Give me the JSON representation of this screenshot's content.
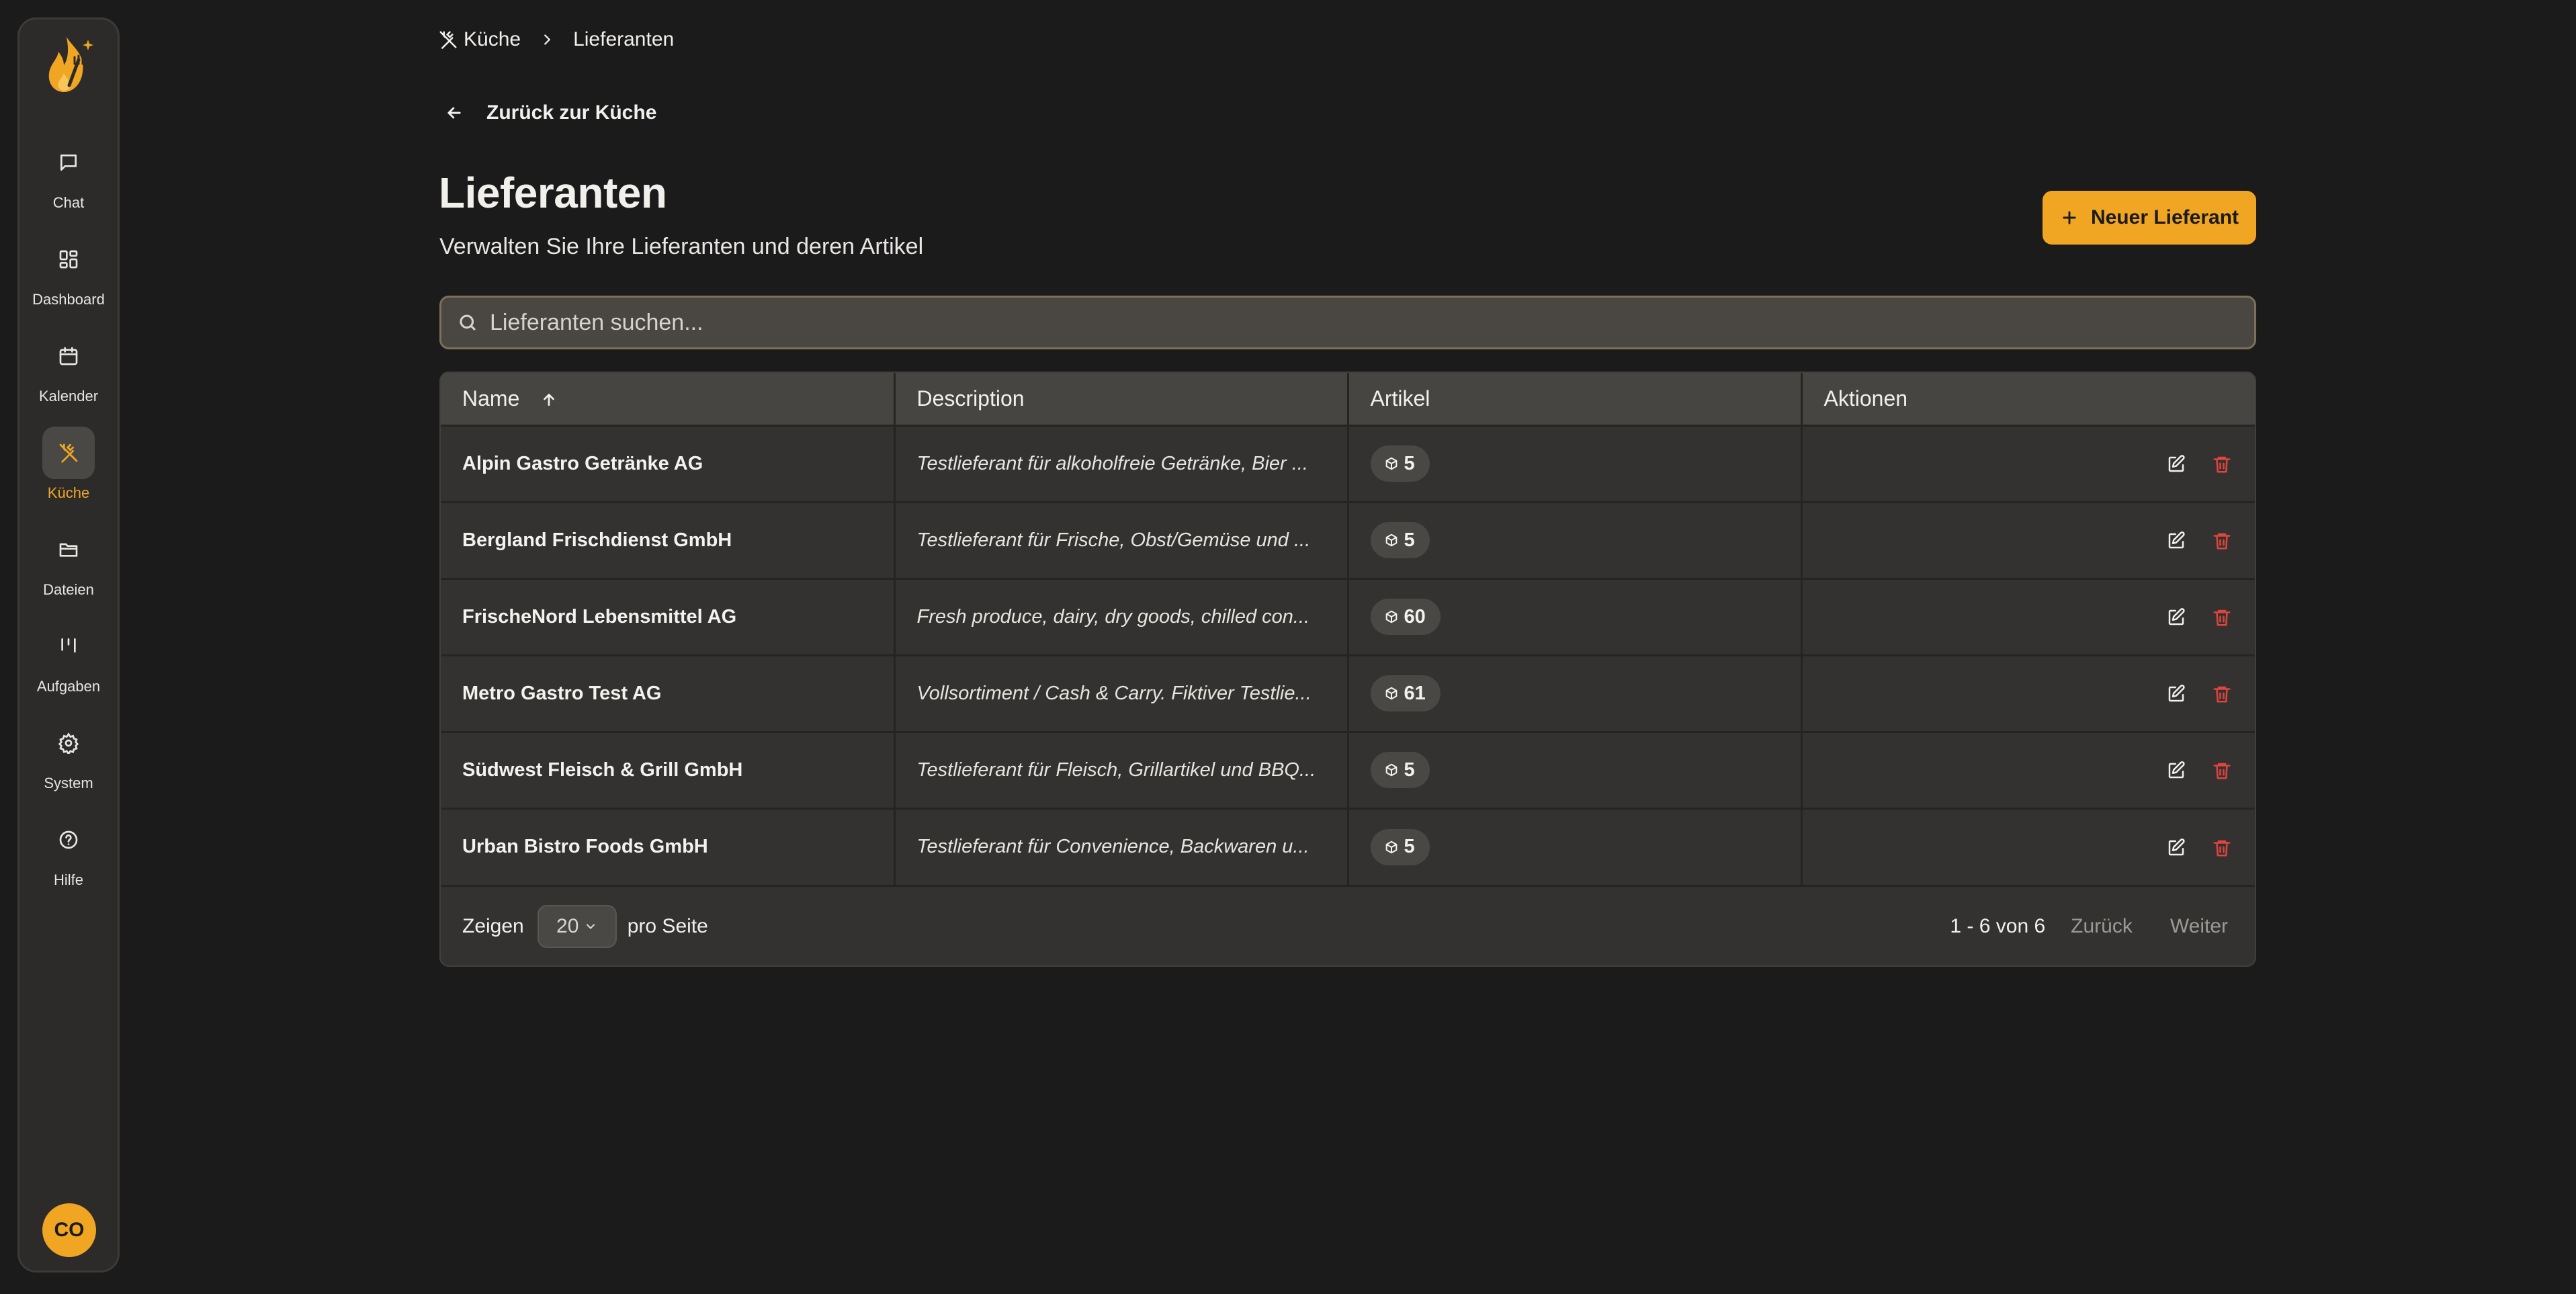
{
  "sidebar": {
    "items": [
      {
        "label": "Chat",
        "icon": "chat-bubble-icon"
      },
      {
        "label": "Dashboard",
        "icon": "grid-icon"
      },
      {
        "label": "Kalender",
        "icon": "calendar-icon"
      },
      {
        "label": "Küche",
        "icon": "utensils-crossed-icon",
        "active": true
      },
      {
        "label": "Dateien",
        "icon": "folder-icon"
      },
      {
        "label": "Aufgaben",
        "icon": "kanban-icon"
      },
      {
        "label": "System",
        "icon": "gear-icon"
      },
      {
        "label": "Hilfe",
        "icon": "help-circle-icon"
      }
    ],
    "avatar_initials": "CO"
  },
  "breadcrumb": {
    "parent": "Küche",
    "current": "Lieferanten"
  },
  "back_link": "Zurück zur Küche",
  "page": {
    "title": "Lieferanten",
    "subtitle": "Verwalten Sie Ihre Lieferanten und deren Artikel",
    "new_button": "Neuer Lieferant"
  },
  "search": {
    "placeholder": "Lieferanten suchen..."
  },
  "table": {
    "columns": [
      "Name",
      "Description",
      "Artikel",
      "Aktionen"
    ],
    "sort": {
      "column": "Name",
      "direction": "ascending"
    },
    "rows": [
      {
        "name": "Alpin Gastro Getränke AG",
        "description": "Testlieferant für alkoholfreie Getränke, Bier ...",
        "articles": "5"
      },
      {
        "name": "Bergland Frischdienst GmbH",
        "description": "Testlieferant für Frische, Obst/Gemüse und ...",
        "articles": "5"
      },
      {
        "name": "FrischeNord Lebensmittel AG",
        "description": "Fresh produce, dairy, dry goods, chilled con...",
        "articles": "60"
      },
      {
        "name": "Metro Gastro Test AG",
        "description": "Vollsortiment / Cash & Carry. Fiktiver Testlie...",
        "articles": "61"
      },
      {
        "name": "Südwest Fleisch & Grill GmbH",
        "description": "Testlieferant für Fleisch, Grillartikel und BBQ...",
        "articles": "5"
      },
      {
        "name": "Urban Bistro Foods GmbH",
        "description": "Testlieferant für Convenience, Backwaren u...",
        "articles": "5"
      }
    ]
  },
  "pagination": {
    "show_label": "Zeigen",
    "page_size": "20",
    "per_page_label": "pro Seite",
    "range": "1 - 6 von 6",
    "prev": "Zurück",
    "next": "Weiter"
  },
  "colors": {
    "accent": "#f0a623",
    "danger": "#e0443e",
    "background": "#1b1b1b"
  }
}
